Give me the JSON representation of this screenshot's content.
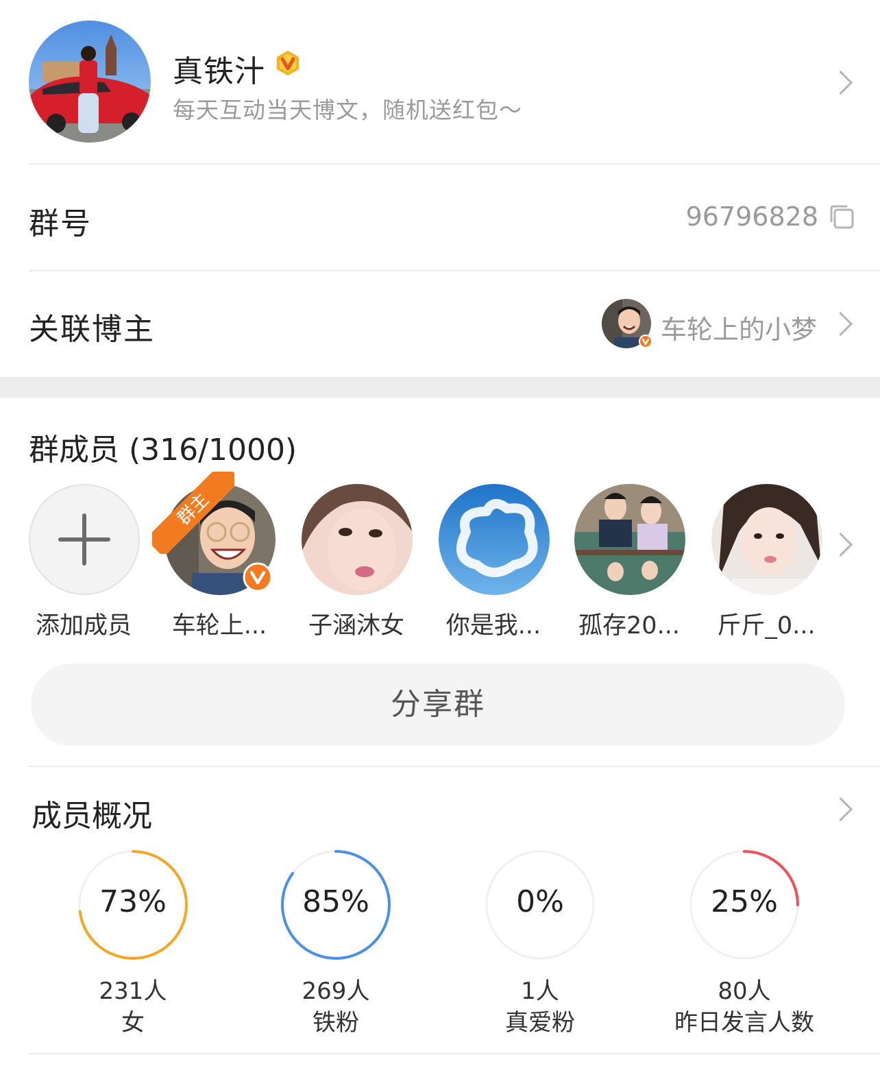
{
  "header": {
    "name": "真铁汁",
    "description": "每天互动当天博文，随机送红包～"
  },
  "group_number": {
    "label": "群号",
    "value": "96796828"
  },
  "linked_blogger": {
    "label": "关联博主",
    "name": "车轮上的小梦"
  },
  "members": {
    "title": "群成员 (316/1000)",
    "owner_tag": "群主",
    "items": [
      {
        "name": "添加成员"
      },
      {
        "name": "车轮上..."
      },
      {
        "name": "子涵沐女"
      },
      {
        "name": "你是我..."
      },
      {
        "name": "孤存20..."
      },
      {
        "name": "斤斤_0..."
      }
    ]
  },
  "share_button": "分享群",
  "overview": {
    "title": "成员概况",
    "stats": [
      {
        "percent_text": "73%",
        "percent": 73,
        "count": "231人",
        "label": "女",
        "color": "#f5a623"
      },
      {
        "percent_text": "85%",
        "percent": 85,
        "count": "269人",
        "label": "铁粉",
        "color": "#4a90e8"
      },
      {
        "percent_text": "0%",
        "percent": 0,
        "count": "1人",
        "label": "真爱粉",
        "color": "#8bc34a"
      },
      {
        "percent_text": "25%",
        "percent": 25,
        "count": "80人",
        "label": "昨日发言人数",
        "color": "#f0505a"
      }
    ]
  }
}
